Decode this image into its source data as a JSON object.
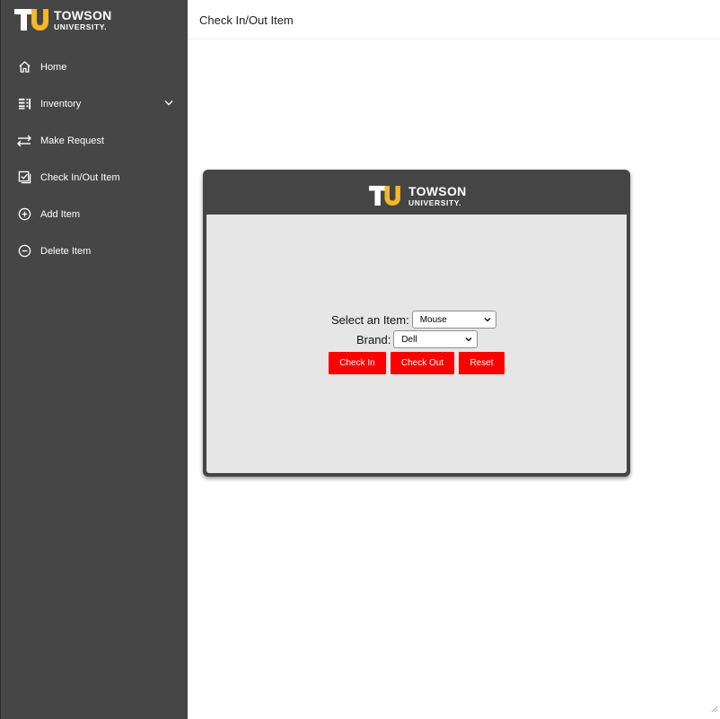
{
  "brand": {
    "line1": "TOWSON",
    "line2": "UNIVERSITY."
  },
  "header": {
    "title": "Check In/Out Item"
  },
  "sidebar": {
    "items": [
      {
        "label": "Home",
        "icon": "home-icon"
      },
      {
        "label": "Inventory",
        "icon": "list-icon",
        "expandable": true
      },
      {
        "label": "Make Request",
        "icon": "swap-arrows-icon"
      },
      {
        "label": "Check In/Out Item",
        "icon": "checklist-icon"
      },
      {
        "label": "Add Item",
        "icon": "plus-circle-icon"
      },
      {
        "label": "Delete Item",
        "icon": "minus-circle-icon"
      }
    ]
  },
  "form": {
    "item_label": "Select an Item:",
    "item_value": "Mouse",
    "brand_label": "Brand:",
    "brand_value": "Dell",
    "check_in_label": "Check In",
    "check_out_label": "Check Out",
    "reset_label": "Reset"
  },
  "colors": {
    "sidebar_bg": "#464646",
    "accent_gold": "#f2b826",
    "button_red": "#ff0000",
    "panel_bg": "#e6e6e6"
  }
}
